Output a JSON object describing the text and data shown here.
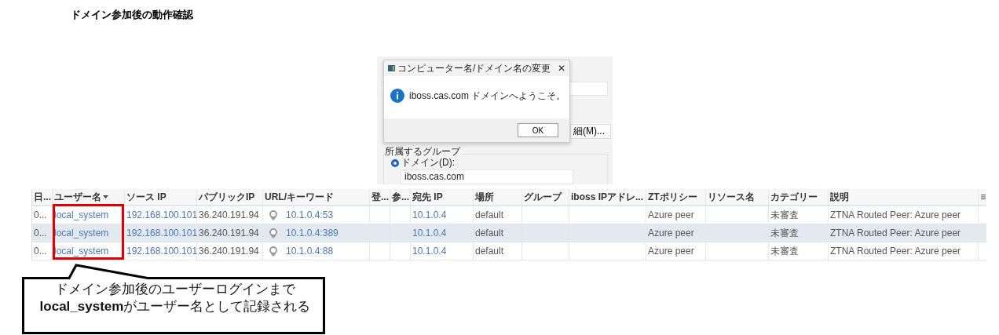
{
  "title": "ドメイン参加後の動作確認",
  "screenshot": {
    "details_button": "細(M)...",
    "group_label": "所属するグループ",
    "domain_radio": {
      "label": "ドメイン(D):",
      "selected": true
    },
    "domain_field": "iboss.cas.com",
    "dialog": {
      "title": "コンピューター名/ドメイン名の変更",
      "close": "✕",
      "message": "iboss.cas.com ドメインへようこそ。",
      "button": "OK"
    }
  },
  "table": {
    "columns": [
      {
        "label": "日...",
        "kind": "text",
        "sorted": false,
        "marked": false
      },
      {
        "label": "ユーザー名",
        "kind": "link",
        "sorted": true,
        "marked": true
      },
      {
        "label": "ソース IP",
        "kind": "link",
        "sorted": false,
        "marked": false
      },
      {
        "label": "パブリックIP",
        "kind": "text",
        "sorted": false,
        "marked": false
      },
      {
        "label": "URL/キーワード",
        "kind": "ip",
        "sorted": false,
        "marked": false
      },
      {
        "label": "登...",
        "sorted": false,
        "marked": false
      },
      {
        "label": "参...",
        "sorted": false,
        "marked": false
      },
      {
        "label": "宛先 IP",
        "kind": "link",
        "sorted": false,
        "marked": false
      },
      {
        "label": "場所",
        "kind": "text",
        "sorted": false,
        "marked": false
      },
      {
        "label": "グループ",
        "sorted": false,
        "marked": false
      },
      {
        "label": "iboss IPアドレ...",
        "sorted": false,
        "marked": false
      },
      {
        "label": "ZTポリシー",
        "kind": "text",
        "sorted": false,
        "marked": false
      },
      {
        "label": "リソース名",
        "sorted": false,
        "marked": false
      },
      {
        "label": "カテゴリー",
        "kind": "text",
        "sorted": false,
        "marked": false
      },
      {
        "label": "説明",
        "kind": "text",
        "sorted": false,
        "marked": false
      }
    ],
    "rows": [
      {
        "highlighted": false,
        "cells": [
          "0...",
          "local_system",
          "192.168.100.101",
          "36.240.191.94",
          "10.1.0.4:53",
          "",
          "",
          "10.1.0.4",
          "default",
          "",
          "",
          "Azure peer",
          "",
          "未審査",
          "ZTNA Routed Peer: Azure peer"
        ]
      },
      {
        "highlighted": true,
        "cells": [
          "0...",
          "local_system",
          "192.168.100.101",
          "36.240.191.94",
          "10.1.0.4:389",
          "",
          "",
          "10.1.0.4",
          "default",
          "",
          "",
          "Azure peer",
          "",
          "未審査",
          "ZTNA Routed Peer: Azure peer"
        ]
      },
      {
        "highlighted": false,
        "cells": [
          "0...",
          "local_system",
          "192.168.100.101",
          "36.240.191.94",
          "10.1.0.4:88",
          "",
          "",
          "10.1.0.4",
          "default",
          "",
          "",
          "Azure peer",
          "",
          "未審査",
          "ZTNA Routed Peer: Azure peer"
        ]
      }
    ]
  },
  "callout": {
    "line1": "ドメイン参加後のユーザーログインまで",
    "line2": "**local_system**がユーザー名として記録される"
  }
}
